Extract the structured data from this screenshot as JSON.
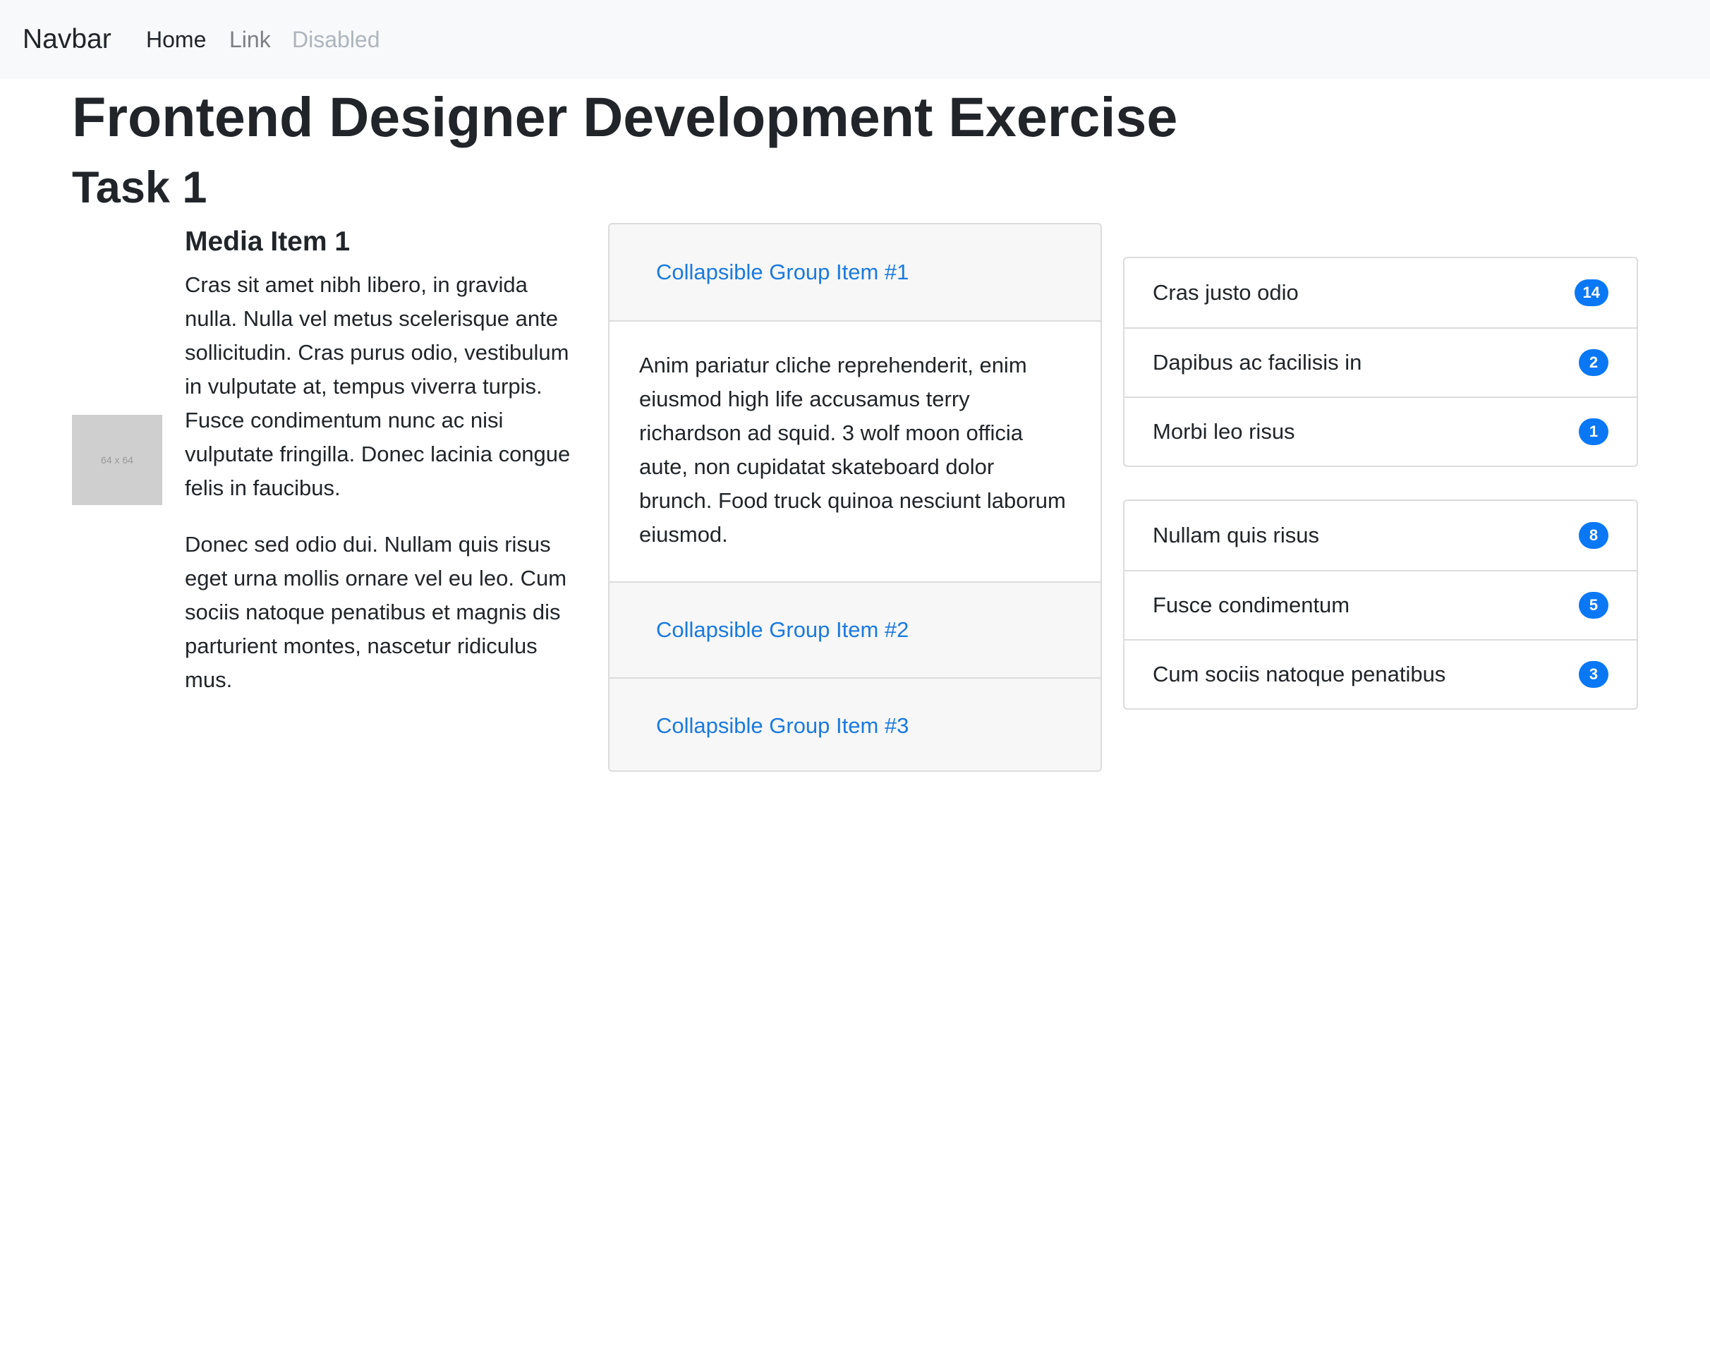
{
  "navbar": {
    "brand": "Navbar",
    "links": [
      {
        "label": "Home",
        "state": "active"
      },
      {
        "label": "Link",
        "state": "normal"
      },
      {
        "label": "Disabled",
        "state": "disabled"
      }
    ]
  },
  "page": {
    "title": "Frontend Designer Development Exercise",
    "task_title": "Task 1"
  },
  "media": {
    "image_label": "64 x 64",
    "title": "Media Item 1",
    "paragraphs": [
      "Cras sit amet nibh libero, in gravida nulla. Nulla vel metus scelerisque ante sollicitudin. Cras purus odio, vestibulum in vulputate at, tempus viverra turpis. Fusce condimentum nunc ac nisi vulputate fringilla. Donec lacinia congue felis in faucibus.",
      "Donec sed odio dui. Nullam quis risus eget urna mollis ornare vel eu leo. Cum sociis natoque penatibus et magnis dis parturient montes, nascetur ridiculus mus."
    ]
  },
  "accordion": {
    "items": [
      {
        "label": "Collapsible Group Item #1",
        "expanded": true
      },
      {
        "label": "Collapsible Group Item #2",
        "expanded": false
      },
      {
        "label": "Collapsible Group Item #3",
        "expanded": false
      }
    ],
    "body": "Anim pariatur cliche reprehenderit, enim eiusmod high life accusamus terry richardson ad squid. 3 wolf moon officia aute, non cupidatat skateboard dolor brunch. Food truck quinoa nesciunt laborum eiusmod."
  },
  "list_group_1": [
    {
      "label": "Cras justo odio",
      "badge": "14"
    },
    {
      "label": "Dapibus ac facilisis in",
      "badge": "2"
    },
    {
      "label": "Morbi leo risus",
      "badge": "1"
    }
  ],
  "list_group_2": [
    {
      "label": "Nullam quis risus",
      "badge": "8"
    },
    {
      "label": "Fusce condimentum",
      "badge": "5"
    },
    {
      "label": "Cum sociis natoque penatibus",
      "badge": "3"
    }
  ],
  "colors": {
    "link": "#1a7ae0",
    "badge": "#0a78f5",
    "navbar_bg": "#f8f9fa"
  }
}
